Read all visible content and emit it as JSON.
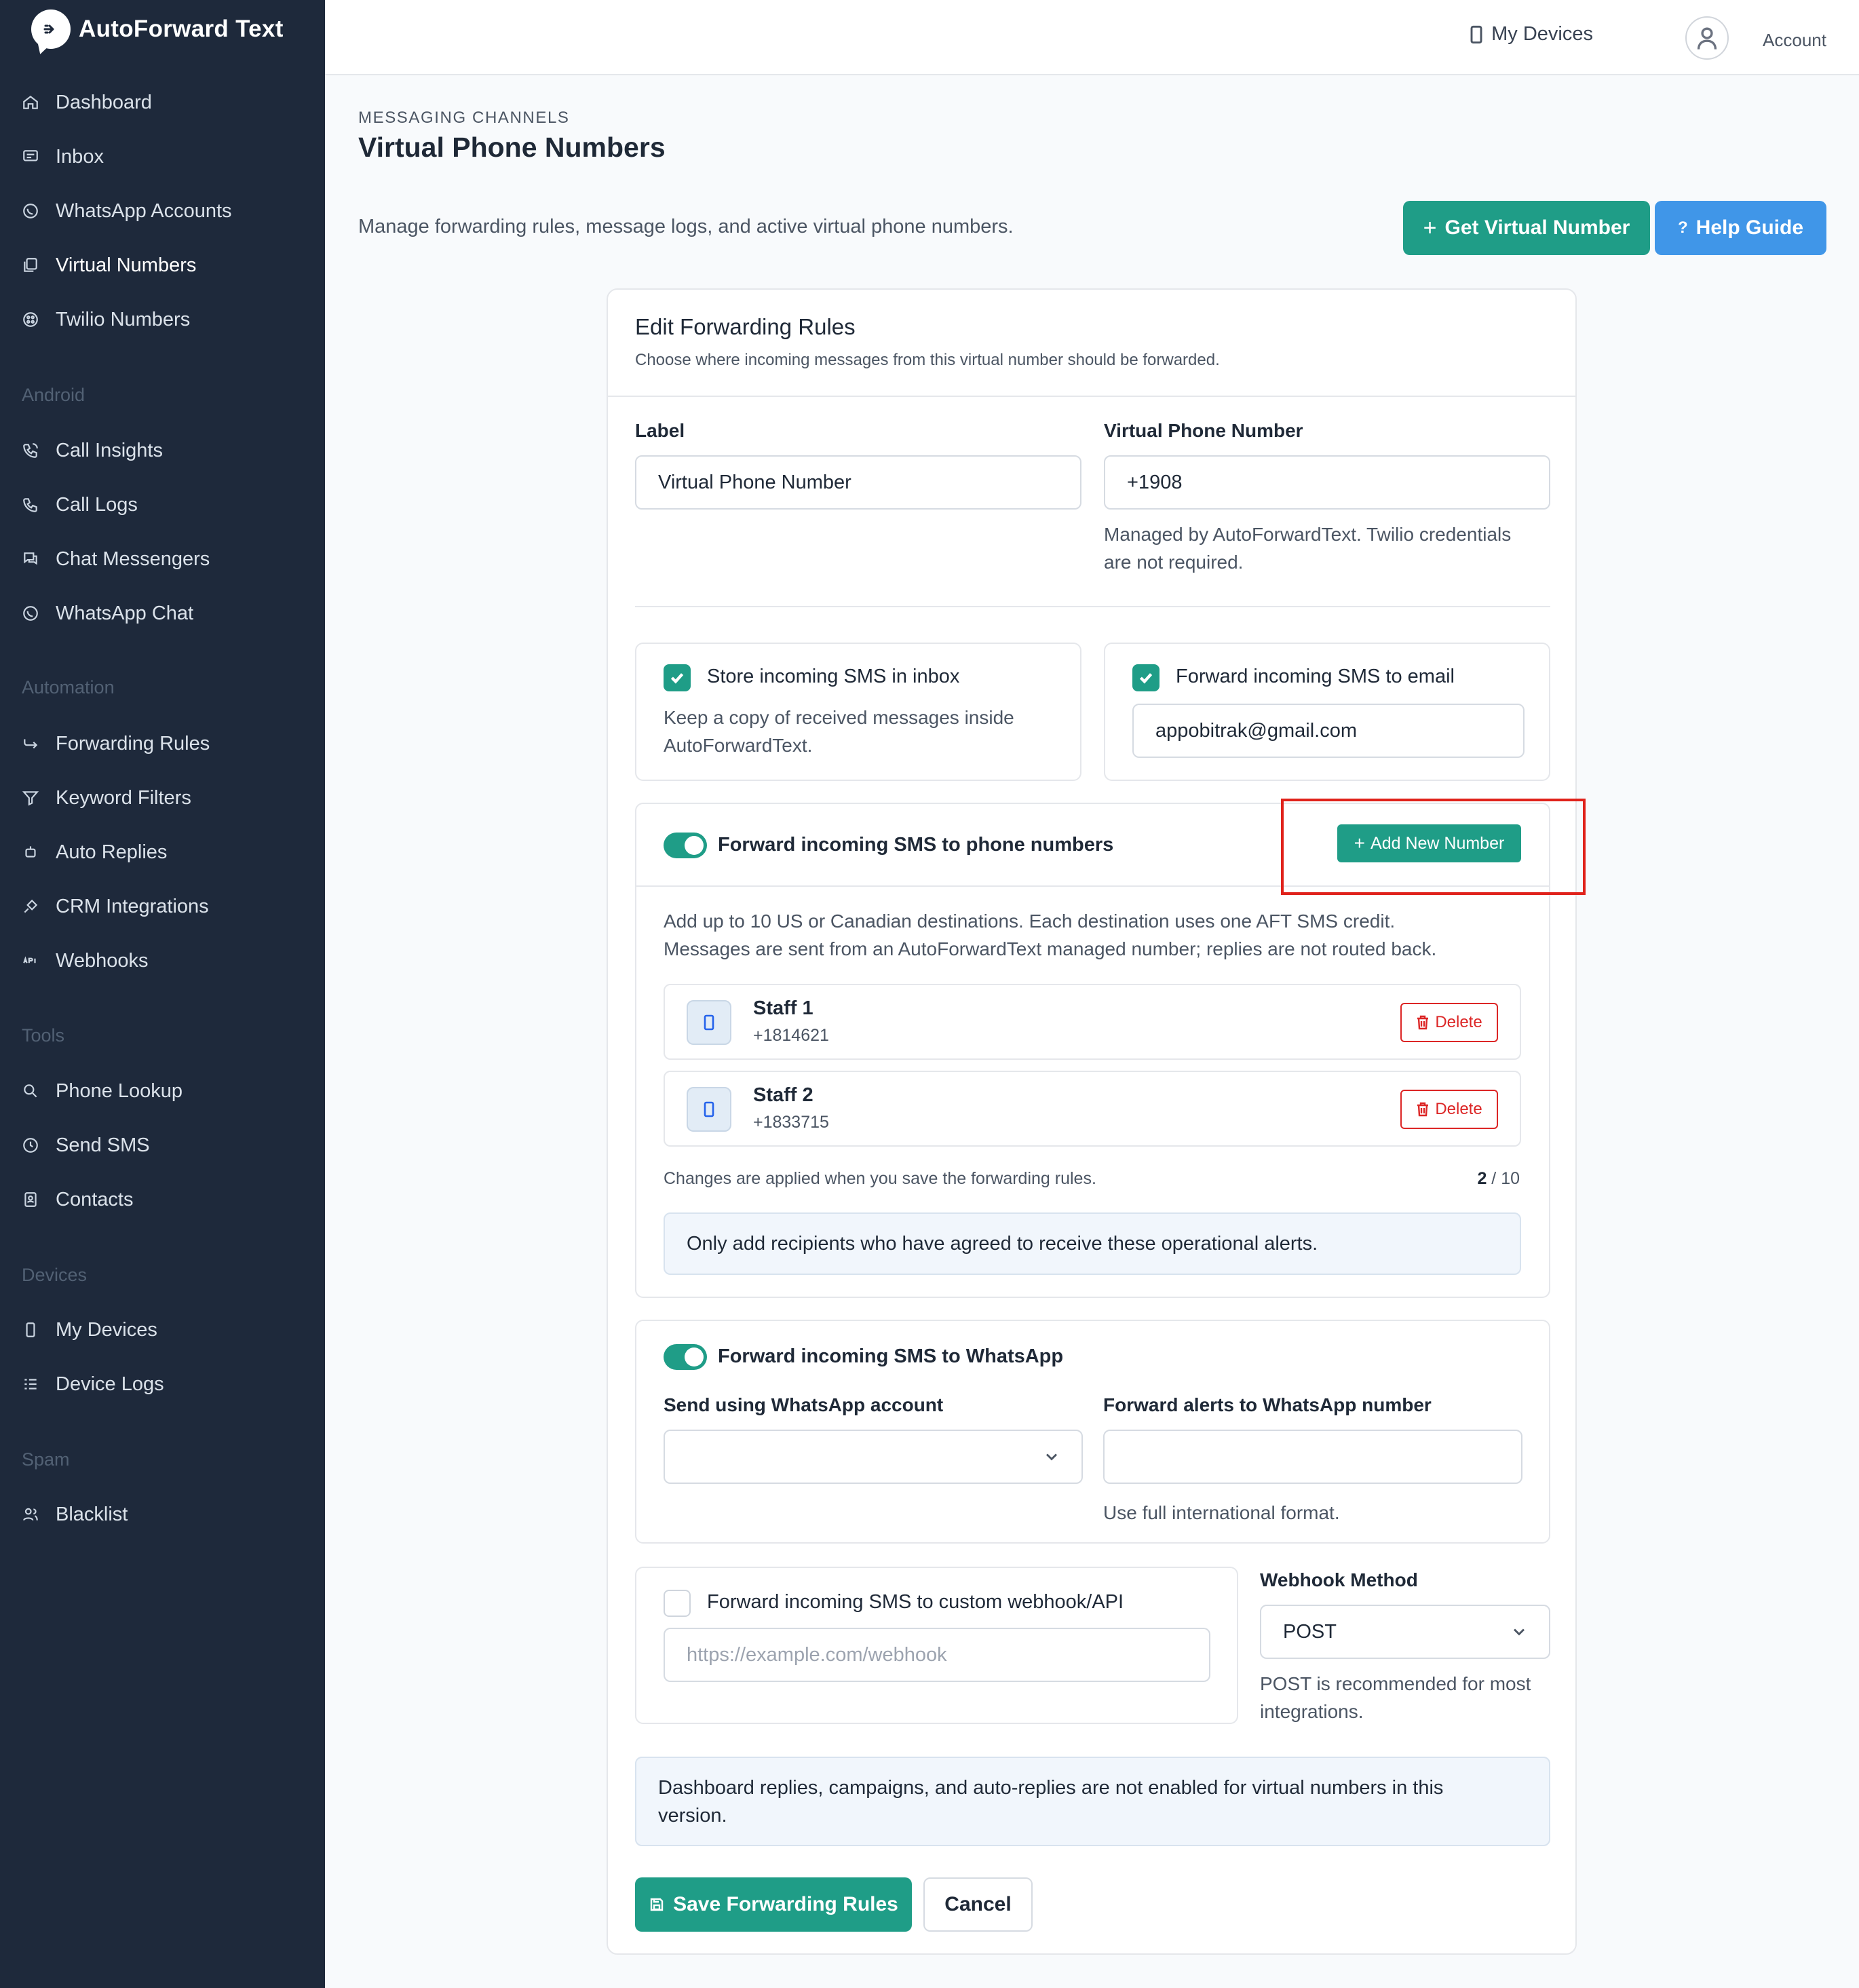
{
  "app": {
    "name": "AutoForward Text"
  },
  "sidebar": {
    "main": [
      {
        "label": "Dashboard",
        "icon": "home-icon"
      },
      {
        "label": "Inbox",
        "icon": "message-icon"
      },
      {
        "label": "WhatsApp Accounts",
        "icon": "whatsapp-icon"
      },
      {
        "label": "Virtual Numbers",
        "icon": "virtual-number-icon"
      },
      {
        "label": "Twilio Numbers",
        "icon": "twilio-icon"
      }
    ],
    "sections": [
      {
        "title": "Android",
        "items": [
          {
            "label": "Call Insights",
            "icon": "phone-call-icon"
          },
          {
            "label": "Call Logs",
            "icon": "phone-icon"
          },
          {
            "label": "Chat Messengers",
            "icon": "chat-icon"
          },
          {
            "label": "WhatsApp Chat",
            "icon": "whatsapp-icon"
          }
        ]
      },
      {
        "title": "Automation",
        "items": [
          {
            "label": "Forwarding Rules",
            "icon": "forward-icon"
          },
          {
            "label": "Keyword Filters",
            "icon": "filter-icon"
          },
          {
            "label": "Auto Replies",
            "icon": "robot-icon"
          },
          {
            "label": "CRM Integrations",
            "icon": "plug-icon"
          },
          {
            "label": "Webhooks",
            "icon": "api-icon"
          }
        ]
      },
      {
        "title": "Tools",
        "items": [
          {
            "label": "Phone Lookup",
            "icon": "search-icon"
          },
          {
            "label": "Send SMS",
            "icon": "clock-icon"
          },
          {
            "label": "Contacts",
            "icon": "contacts-icon"
          }
        ]
      },
      {
        "title": "Devices",
        "items": [
          {
            "label": "My Devices",
            "icon": "mobile-icon"
          },
          {
            "label": "Device Logs",
            "icon": "list-icon"
          }
        ]
      },
      {
        "title": "Spam",
        "items": [
          {
            "label": "Blacklist",
            "icon": "users-block-icon"
          }
        ]
      }
    ],
    "active": "Virtual Numbers"
  },
  "topbar": {
    "devices_label": "My Devices",
    "account_label": "Account"
  },
  "header": {
    "eyebrow": "MESSAGING CHANNELS",
    "title": "Virtual Phone Numbers",
    "description": "Manage forwarding rules, message logs, and active virtual phone numbers.",
    "get_number_label": "Get Virtual Number",
    "help_label": "Help Guide"
  },
  "form": {
    "title": "Edit Forwarding Rules",
    "subtitle": "Choose where incoming messages from this virtual number should be forwarded.",
    "label_field": {
      "label": "Label",
      "value": "Virtual Phone Number"
    },
    "number_field": {
      "label": "Virtual Phone Number",
      "value": "+1908",
      "help_1": "Managed by AutoForwardText. Twilio credentials",
      "help_2": "are not required."
    },
    "store_inbox": {
      "label": "Store incoming SMS in inbox",
      "desc_1": "Keep a copy of received messages inside",
      "desc_2": "AutoForwardText.",
      "checked": true
    },
    "email_forward": {
      "label": "Forward incoming SMS to email",
      "value": "appobitrak@gmail.com",
      "checked": true
    },
    "phone_forward": {
      "label": "Forward incoming SMS to phone numbers",
      "enabled": true,
      "add_label": "Add New Number",
      "desc_1": "Add up to 10 US or Canadian destinations. Each destination uses one AFT SMS credit.",
      "desc_2": "Messages are sent from an AutoForwardText managed number; replies are not routed back.",
      "recipients": [
        {
          "name": "Staff 1",
          "number": "+1814621"
        },
        {
          "name": "Staff 2",
          "number": "+1833715"
        }
      ],
      "delete_label": "Delete",
      "note": "Changes are applied when you save the forwarding rules.",
      "count": "2",
      "max": "/ 10",
      "consent": "Only add recipients who have agreed to receive these operational alerts."
    },
    "whatsapp": {
      "label": "Forward incoming SMS to WhatsApp",
      "enabled": true,
      "account_label": "Send using WhatsApp account",
      "account_value": "",
      "number_label": "Forward alerts to WhatsApp number",
      "number_value": "",
      "number_help": "Use full international format."
    },
    "webhook": {
      "label": "Forward incoming SMS to custom webhook/API",
      "checked": false,
      "placeholder": "https://example.com/webhook",
      "method_label": "Webhook Method",
      "method_value": "POST",
      "method_help_1": "POST is recommended for most",
      "method_help_2": "integrations."
    },
    "notice_1": "Dashboard replies, campaigns, and auto-replies are not enabled for virtual numbers in this",
    "notice_2": "version.",
    "save_label": "Save Forwarding Rules",
    "cancel_label": "Cancel"
  },
  "colors": {
    "sidebar_bg": "#1e293b",
    "accent_green": "#1f9d87",
    "accent_blue": "#4096e8",
    "danger": "#dc2626",
    "highlight": "#e0221b"
  }
}
